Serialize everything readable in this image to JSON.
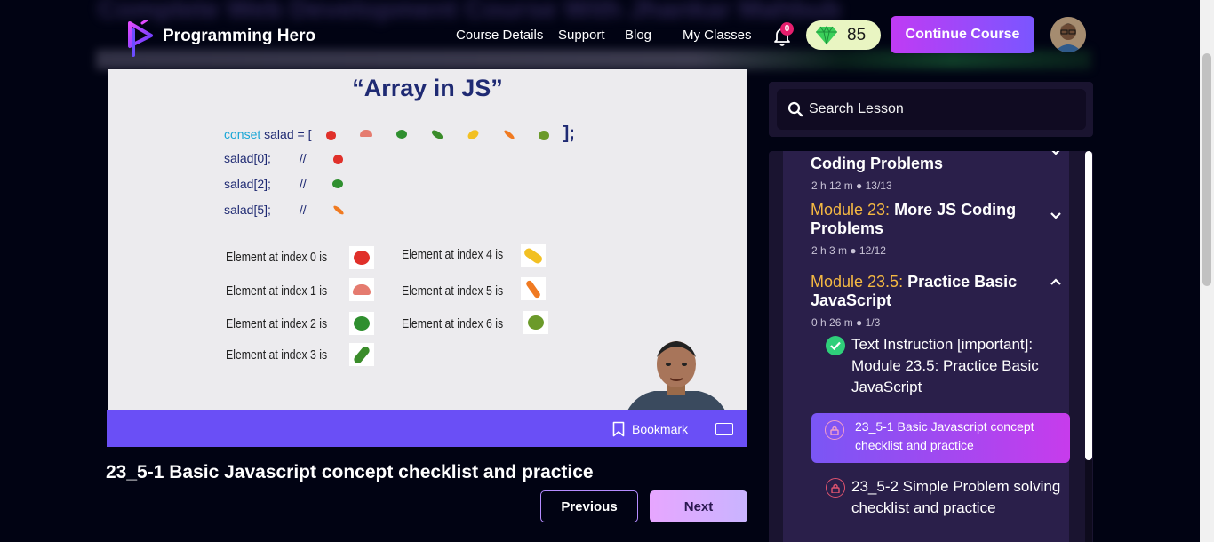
{
  "header": {
    "blurred_title": "Complete Web Development Course With Jhankar Mahbub",
    "brand": "Programming Hero",
    "nav_links": [
      "Course Details",
      "Support",
      "Blog",
      "My Classes"
    ],
    "notification_count": "0",
    "gems": "85",
    "continue_label": "Continue Course"
  },
  "video": {
    "slide_title": "“Array in JS”",
    "code": {
      "keyword": "conset",
      "decl": "salad = [",
      "close": "];",
      "lines": [
        "salad[0];",
        "salad[2];",
        "salad[5];"
      ],
      "comment": "//"
    },
    "elements": [
      "Element at index 0 is",
      "Element at index 1 is",
      "Element at index 2 is",
      "Element at index 3 is",
      "Element at index 4 is",
      "Element at index 5 is",
      "Element at index 6 is"
    ],
    "bookmark_label": "Bookmark"
  },
  "lesson": {
    "title": "23_5-1 Basic Javascript concept checklist and practice",
    "prev_label": "Previous",
    "next_label": "Next"
  },
  "sidebar": {
    "search_placeholder": "Search Lesson",
    "modules": [
      {
        "number": "",
        "title": "Coding Problems",
        "meta": "2 h 12 m ●  13/13",
        "expanded": false
      },
      {
        "number": "Module 23:",
        "title": "More JS Coding Problems",
        "meta": "2 h 3 m ●  12/12",
        "expanded": false
      },
      {
        "number": "Module 23.5:",
        "title": "Practice Basic JavaScript",
        "meta": "0 h 26 m ●  1/3",
        "expanded": true
      }
    ],
    "items": [
      {
        "title": "Text Instruction [important]: Module 23.5: Practice Basic JavaScript",
        "status": "completed"
      },
      {
        "title": "23_5-1 Basic Javascript concept checklist and practice",
        "status": "active"
      },
      {
        "title": "23_5-2 Simple Problem solving checklist and practice",
        "status": "locked"
      }
    ]
  }
}
